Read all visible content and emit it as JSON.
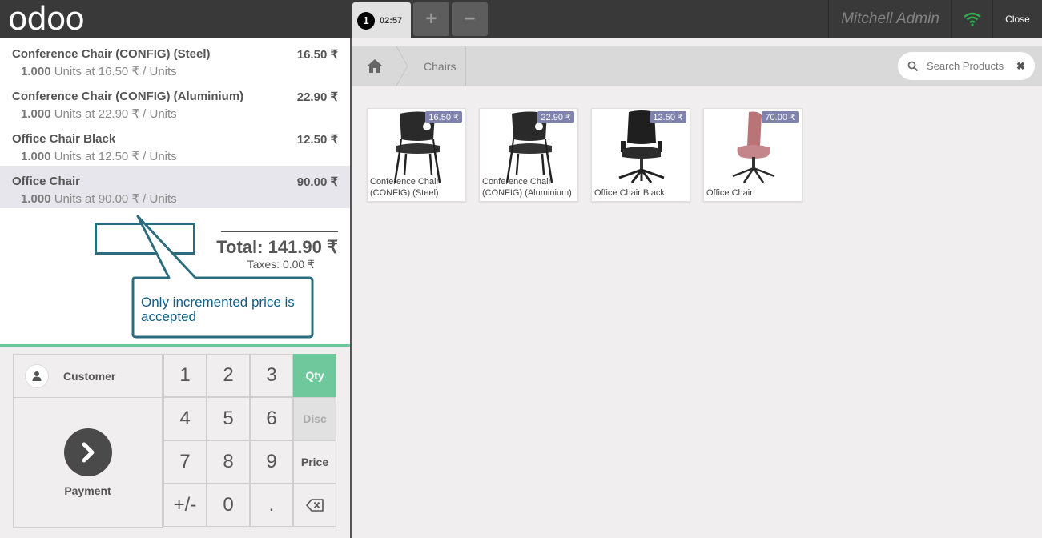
{
  "topbar": {
    "logo": "odoo",
    "order_tab": {
      "number": "1",
      "time": "02:57"
    },
    "add_order_label": "+",
    "remove_order_label": "−",
    "user": "Mitchell Admin",
    "close_label": "Close"
  },
  "orderlines": [
    {
      "name": "Conference Chair (CONFIG) (Steel)",
      "price": "16.50 ₹",
      "qty": "1.000",
      "info": " Units at 16.50 ₹ / Units",
      "selected": false
    },
    {
      "name": "Conference Chair (CONFIG) (Aluminium)",
      "price": "22.90 ₹",
      "qty": "1.000",
      "info": " Units at 22.90 ₹ / Units",
      "selected": false
    },
    {
      "name": "Office Chair Black",
      "price": "12.50 ₹",
      "qty": "1.000",
      "info": " Units at 12.50 ₹ / Units",
      "selected": false
    },
    {
      "name": "Office Chair",
      "price": "90.00 ₹",
      "qty": "1.000",
      "info": " Units at 90.00 ₹ / Units",
      "selected": true
    }
  ],
  "summary": {
    "total": "Total: 141.90 ₹",
    "taxes": "Taxes: 0.00 ₹"
  },
  "callout": {
    "text": "Only incremented price is accepted"
  },
  "controls": {
    "customer_label": "Customer",
    "payment_label": "Payment",
    "keys": [
      "1",
      "2",
      "3",
      "Qty",
      "4",
      "5",
      "6",
      "Disc",
      "7",
      "8",
      "9",
      "Price",
      "+/-",
      "0",
      "."
    ],
    "active_mode": "Qty",
    "disabled_mode": "Disc"
  },
  "products_header": {
    "breadcrumb": "Chairs",
    "search_placeholder": "Search Products"
  },
  "products": [
    {
      "name": "Conference Chair (CONFIG) (Steel)",
      "price": "16.50 ₹",
      "icon": "black-stacking-chair-icon"
    },
    {
      "name": "Conference Chair (CONFIG) (Aluminium)",
      "price": "22.90 ₹",
      "icon": "black-stacking-chair-icon"
    },
    {
      "name": "Office Chair Black",
      "price": "12.50 ₹",
      "icon": "black-office-chair-icon"
    },
    {
      "name": "Office Chair",
      "price": "70.00 ₹",
      "icon": "pink-swivel-chair-icon"
    }
  ],
  "colors": {
    "accent": "#6ec89b",
    "topbar": "#393939",
    "price_tag": "#7f82ac",
    "callout": "#2b6d7e"
  }
}
